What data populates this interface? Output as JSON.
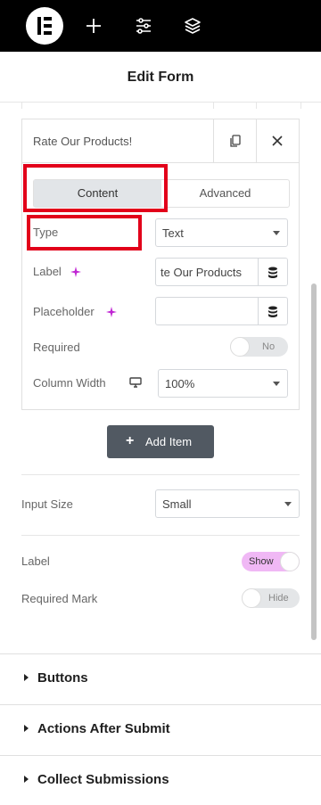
{
  "header": {
    "title": "Edit Form"
  },
  "item": {
    "name": "Rate Our Products!",
    "tabs": {
      "content": "Content",
      "advanced": "Advanced"
    },
    "type": {
      "label": "Type",
      "value": "Text"
    },
    "label": {
      "label": "Label",
      "value": "te Our Products"
    },
    "placeholder": {
      "label": "Placeholder",
      "value": ""
    },
    "required": {
      "label": "Required",
      "state": "No"
    },
    "column_width": {
      "label": "Column Width",
      "value": "100%"
    }
  },
  "add_item": "Add Item",
  "input_size": {
    "label": "Input Size",
    "value": "Small"
  },
  "label_toggle": {
    "label": "Label",
    "state": "Show"
  },
  "required_mark": {
    "label": "Required Mark",
    "state": "Hide"
  },
  "sections": [
    "Buttons",
    "Actions After Submit",
    "Collect Submissions"
  ],
  "colors": {
    "topbar": "#000000",
    "highlight": "#e2001a",
    "toggle_on": "#f0b8f5",
    "ai_sparkle": "#c026d3",
    "button": "#515962"
  }
}
